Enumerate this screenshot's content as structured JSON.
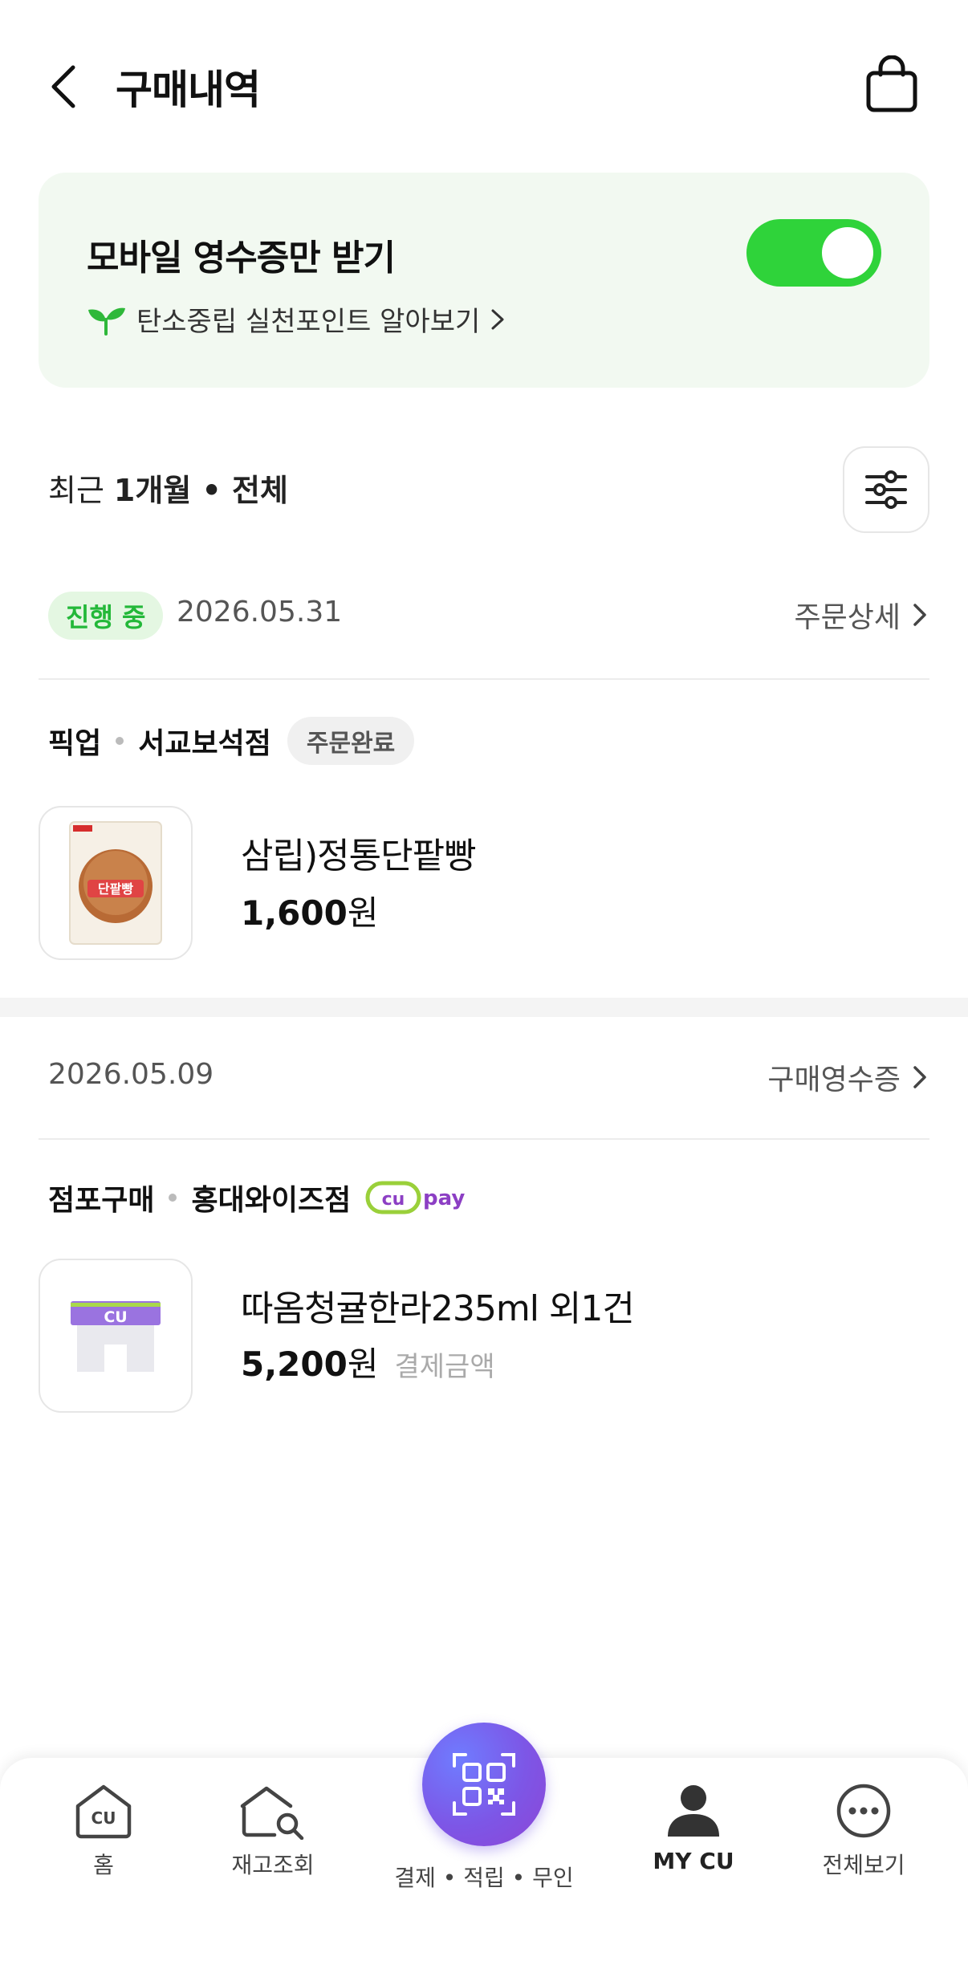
{
  "header": {
    "title": "구매내역"
  },
  "receipt_setting": {
    "title": "모바일 영수증만 받기",
    "toggle_on": true,
    "carbon_link": "탄소중립 실천포인트 알아보기"
  },
  "filter": {
    "prefix": "최근",
    "value": "1개월 • 전체"
  },
  "orders": [
    {
      "status": "진행 중",
      "date": "2026.05.31",
      "link": "주문상세",
      "type": "픽업",
      "store": "서교보석점",
      "badge": "주문완료",
      "product": "삼립)정통단팥빵",
      "thumb_text": "단팥빵",
      "price_num": "1,600",
      "price_unit": "원"
    },
    {
      "date": "2026.05.09",
      "link": "구매영수증",
      "type": "점포구매",
      "store": "홍대와이즈점",
      "pay_logo": "pay",
      "product": "따옴청귤한라235ml 외1건",
      "thumb_text": "CU",
      "price_num": "5,200",
      "price_unit": "원",
      "price_note": "결제금액"
    }
  ],
  "nav": {
    "home": "홈",
    "stock": "재고조회",
    "pay": "결제 • 적립 • 무인",
    "mycu": "MY CU",
    "all": "전체보기"
  },
  "colors": {
    "accent_green": "#2fd33a",
    "badge_green": "#23b839",
    "pay_purple": "#7d56e6"
  }
}
